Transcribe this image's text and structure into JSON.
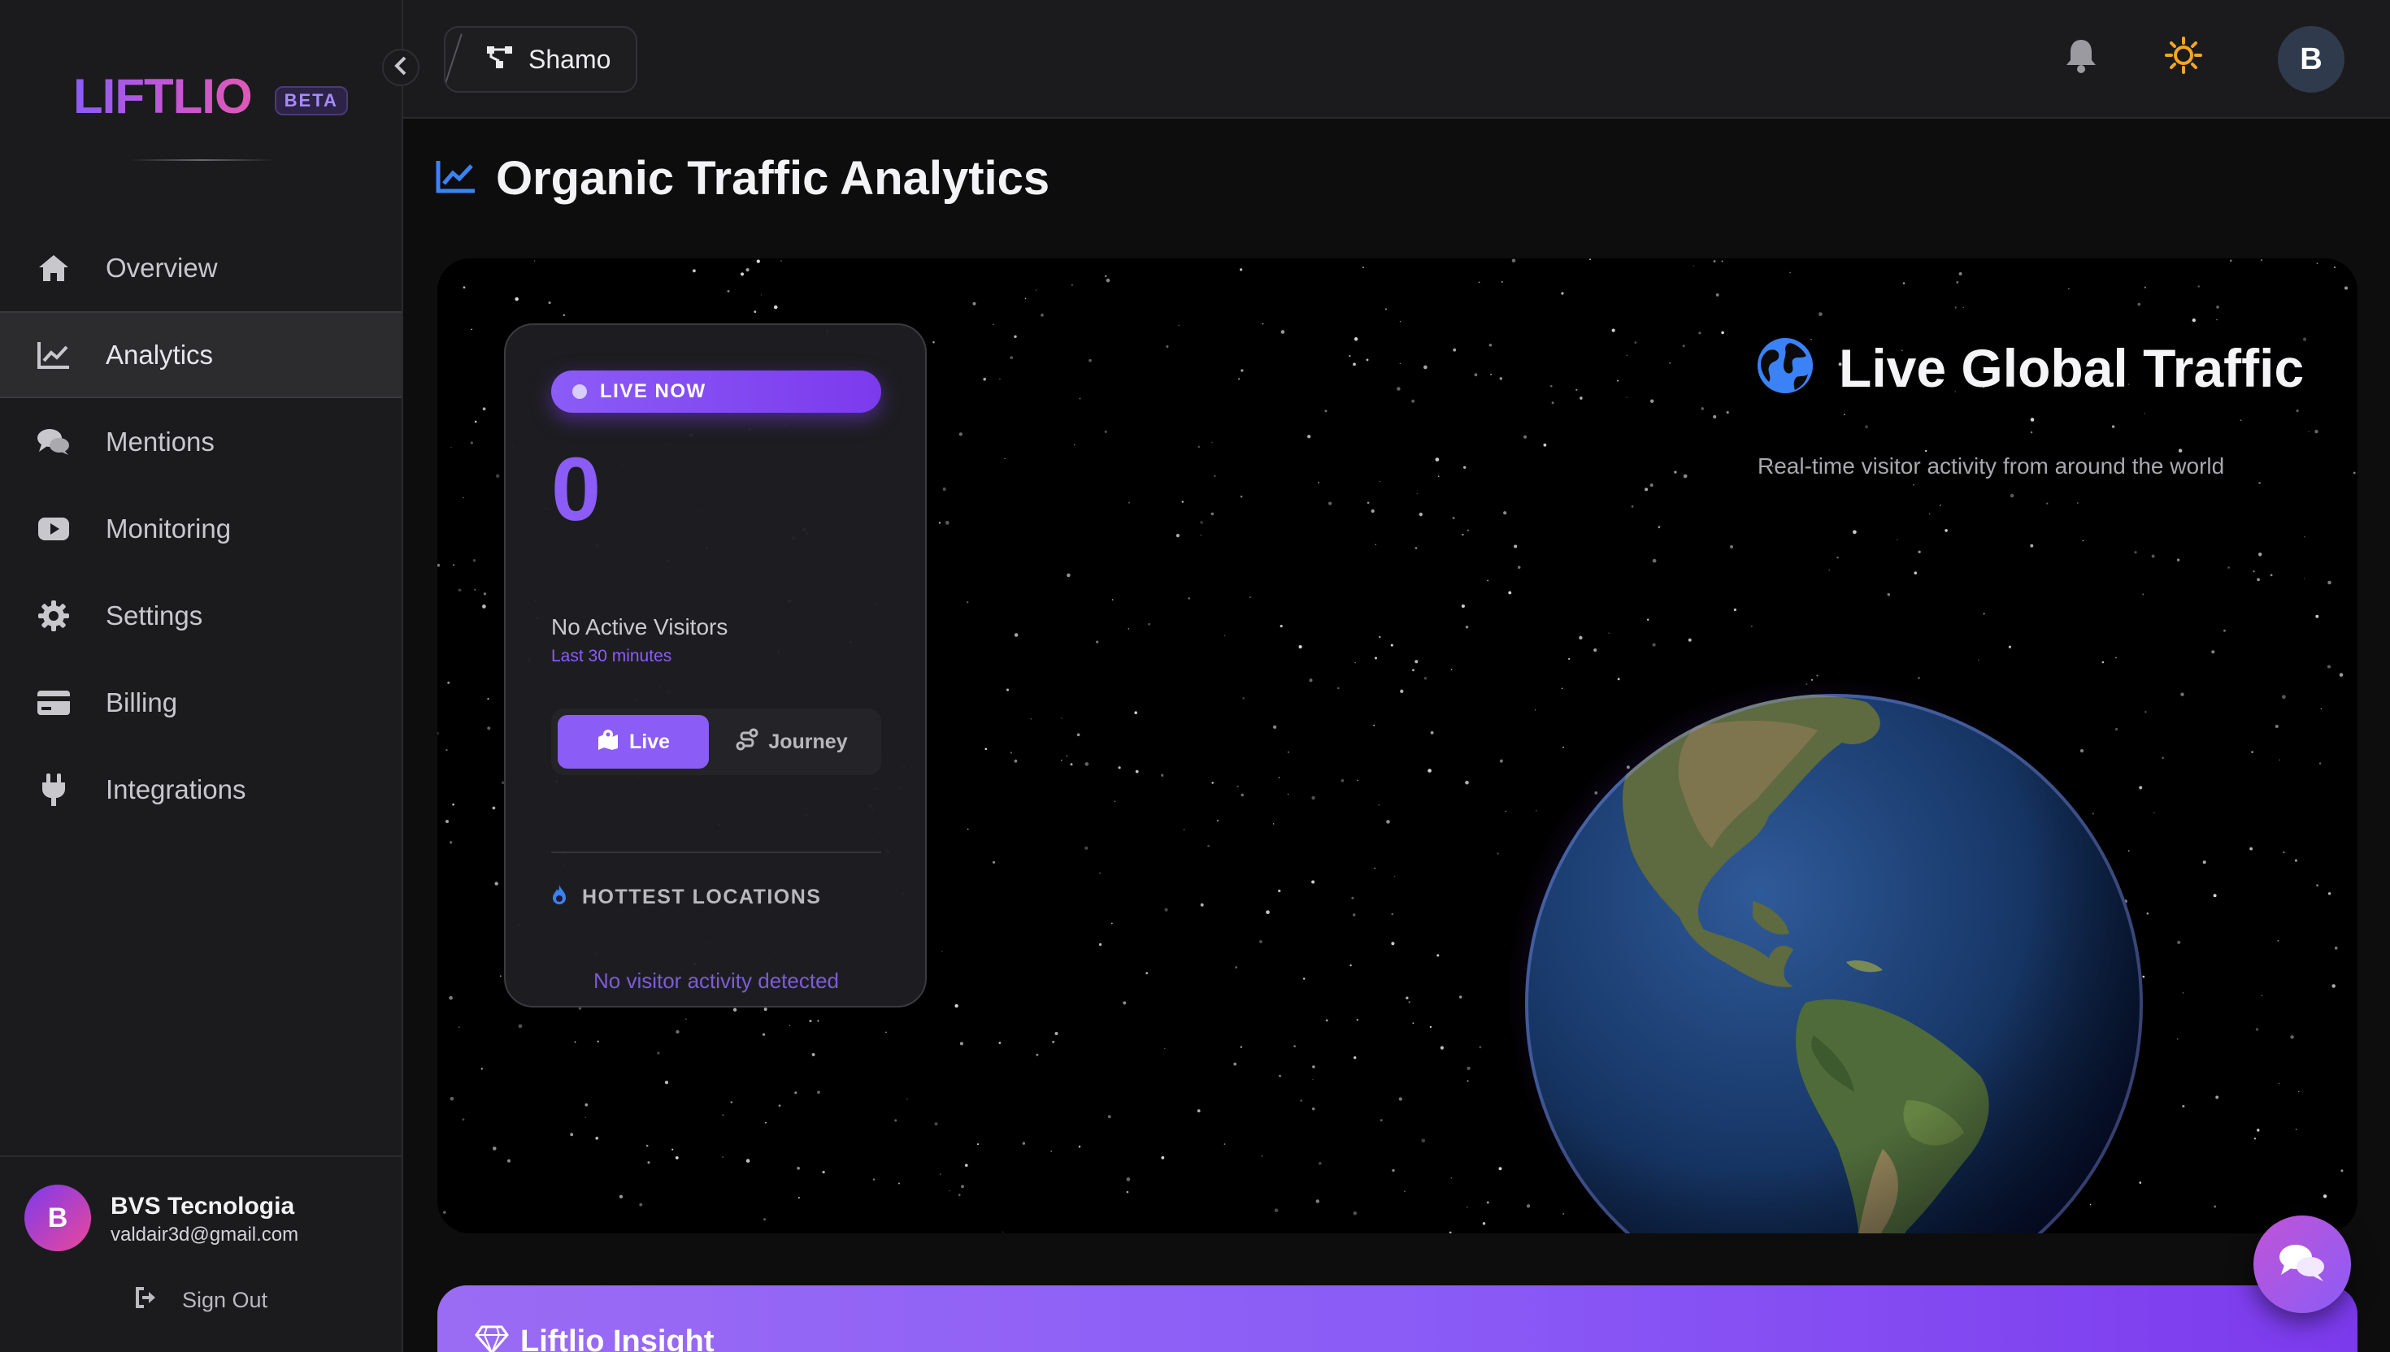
{
  "brand": {
    "logo": "LIFTLIO",
    "badge": "BETA"
  },
  "sidebar": {
    "items": [
      {
        "label": "Overview",
        "icon": "home-icon"
      },
      {
        "label": "Analytics",
        "icon": "chart-line-icon",
        "active": true
      },
      {
        "label": "Mentions",
        "icon": "comments-icon"
      },
      {
        "label": "Monitoring",
        "icon": "youtube-icon"
      },
      {
        "label": "Settings",
        "icon": "gear-icon"
      },
      {
        "label": "Billing",
        "icon": "credit-card-icon"
      },
      {
        "label": "Integrations",
        "icon": "plug-icon"
      }
    ],
    "user": {
      "initial": "B",
      "name": "BVS Tecnologia",
      "email": "valdair3d@gmail.com"
    },
    "signout_label": "Sign Out"
  },
  "topbar": {
    "project_name": "Shamo",
    "avatar_initial": "B"
  },
  "page": {
    "title": "Organic Traffic Analytics"
  },
  "live_card": {
    "badge": "LIVE NOW",
    "count": "0",
    "label": "No Active Visitors",
    "sub": "Last 30 minutes",
    "toggle": {
      "live": "Live",
      "journey": "Journey"
    },
    "hottest_title": "HOTTEST LOCATIONS",
    "hottest_empty": "No visitor activity detected"
  },
  "globe": {
    "title": "Live Global Traffic",
    "subtitle": "Real-time visitor activity from around the world"
  },
  "insight": {
    "title": "Liftlio Insight"
  },
  "colors": {
    "accent": "#8b5cf6",
    "sidebar_bg": "#1b1b1d",
    "page_bg": "#0d0d0e",
    "sun": "#f5a623",
    "chart_icon_blue": "#3b82f6"
  }
}
